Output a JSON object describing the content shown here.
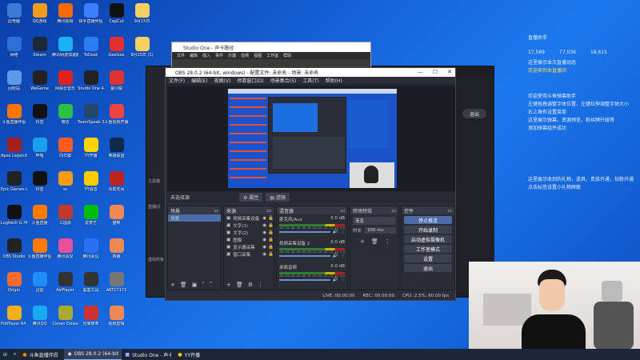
{
  "desktop": {
    "icons": [
      {
        "label": "此电脑",
        "c": "#3a7bd5"
      },
      {
        "label": "QQ游戏",
        "c": "#f29c1f"
      },
      {
        "label": "腾讯视频",
        "c": "#ff6a00"
      },
      {
        "label": "快手直播伴侣",
        "c": "#3b7fff"
      },
      {
        "label": "CapCut",
        "c": "#111"
      },
      {
        "label": "9月15日",
        "c": "#f3d061"
      },
      {
        "label": "网络",
        "c": "#2c6fd6"
      },
      {
        "label": "Steam",
        "c": "#1b2838"
      },
      {
        "label": "腾讯网游加速器",
        "c": "#1db0f4"
      },
      {
        "label": "ToDesk",
        "c": "#2d7cf6"
      },
      {
        "label": "GeeGee",
        "c": "#e03030"
      },
      {
        "label": "9月15日 (1)",
        "c": "#f3d061"
      },
      {
        "label": "回收站",
        "c": "#5b9ae8"
      },
      {
        "label": "WeGame",
        "c": "#222"
      },
      {
        "label": "网易云音乐",
        "c": "#e1211c"
      },
      {
        "label": "Studio One 4",
        "c": "#222"
      },
      {
        "label": "金闪锐",
        "c": "#d33"
      },
      {
        "label": "斗鱼直播伴侣",
        "c": "#ff7300"
      },
      {
        "label": "抖音",
        "c": "#111"
      },
      {
        "label": "微信",
        "c": "#2ac145"
      },
      {
        "label": "TeamSpeak 3",
        "c": "#23486b"
      },
      {
        "label": "斗鱼视频开播",
        "c": "#e44"
      },
      {
        "label": "Apex Legends",
        "c": "#a3201e"
      },
      {
        "label": "哔哩",
        "c": "#1d9ff0"
      },
      {
        "label": "向日葵",
        "c": "#ff5a1f"
      },
      {
        "label": "YY开播",
        "c": "#ffd200"
      },
      {
        "label": "英雄联盟",
        "c": "#0f2a4a"
      },
      {
        "label": "Epic Games Launcher",
        "c": "#222"
      },
      {
        "label": "抖音",
        "c": "#111"
      },
      {
        "label": "ss",
        "c": "#f39c12"
      },
      {
        "label": "YY语音",
        "c": "#ffcc00"
      },
      {
        "label": "永劫无间",
        "c": "#b22"
      },
      {
        "label": "Logitech G HUB",
        "c": "#111"
      },
      {
        "label": "斗鱼直播",
        "c": "#ff7a00"
      },
      {
        "label": "三国杀",
        "c": "#c0392b"
      },
      {
        "label": "爱奇艺",
        "c": "#00be06"
      },
      {
        "label": "猫咪",
        "c": "#e85"
      },
      {
        "label": "OBS Studio",
        "c": "#222"
      },
      {
        "label": "斗鱼直播伴侣",
        "c": "#ff7a00"
      },
      {
        "label": "腾讯会议",
        "c": "#e94f9c"
      },
      {
        "label": "腾讯会议",
        "c": "#2b6ff5"
      },
      {
        "label": "转播",
        "c": "#e85"
      },
      {
        "label": "Origin",
        "c": "#f56c2d"
      },
      {
        "label": "迅雷",
        "c": "#1e8ef7"
      },
      {
        "label": "AirPlayer",
        "c": "#333"
      },
      {
        "label": "黑盒工具",
        "c": "#333"
      },
      {
        "label": "AKT17173",
        "c": "#777"
      },
      {
        "label": "PotPlayer 64 bit",
        "c": "#f2b01e"
      },
      {
        "label": "腾讯QQ",
        "c": "#19a9f2"
      },
      {
        "label": "Conan Exiles",
        "c": "#aa3"
      },
      {
        "label": "光荣使命",
        "c": "#c33"
      },
      {
        "label": "视频剪辑",
        "c": "#e85"
      }
    ]
  },
  "studio_window": {
    "title": "Studio One - 声卡路径",
    "menu": [
      "文件",
      "编辑",
      "插入",
      "事件",
      "乐器",
      "音频",
      "视图",
      "工作室",
      "帮助"
    ]
  },
  "streamer_app": {
    "sidebar": [
      "工具箱",
      "直播间",
      "虚拟形象"
    ],
    "right_buttons": [
      "退出"
    ]
  },
  "obs": {
    "title": "OBS 28.0.2 (64-bit, windows) - 配置文件: 未命名 - 场景: 未命名",
    "menu": [
      "文件(F)",
      "编辑(E)",
      "视图(V)",
      "停靠窗口(D)",
      "场景集合(S)",
      "工具(T)",
      "帮助(H)"
    ],
    "context": {
      "source": "未选择源",
      "props": "属性",
      "filters": "滤镜"
    },
    "scenes": {
      "title": "场景",
      "items": [
        "场景"
      ]
    },
    "sources": {
      "title": "来源",
      "items": [
        "视频采集设备",
        "文字(1)",
        "文字(2)",
        "图像",
        "显示器采集",
        "窗口采集"
      ]
    },
    "mixer": {
      "title": "混音器",
      "tracks": [
        {
          "name": "麦克风/Aux",
          "db": "0.0 dB"
        },
        {
          "name": "视频采集设备 2",
          "db": "0.0 dB"
        },
        {
          "name": "桌面音频",
          "db": "0.0 dB"
        }
      ],
      "scale": "-60 -55 -50 -45 -40 -35 -30 -25 -20 -15 -10 -5 0"
    },
    "transitions": {
      "title": "转场特效",
      "type": "渐变",
      "duration_label": "时长",
      "duration": "300 ms"
    },
    "controls": {
      "title": "控件",
      "stop_stream": "停止推流",
      "start_record": "开始录制",
      "virtual_cam": "启动虚拟摄像机",
      "studio_mode": "工作室模式",
      "settings": "设置",
      "exit": "退出"
    },
    "status": {
      "live": "LIVE: 00:00:00",
      "rec": "REC: 00:00:00",
      "cpu": "CPU: 2.5%, 60.00 fps"
    }
  },
  "notifications": {
    "header": "直播助手",
    "stats": [
      "17,569",
      "77,036",
      "18,615"
    ],
    "lines": [
      "这里展示本次直播动态",
      "欢迎来到本直播间"
    ],
    "tips": [
      "欢迎使用斗鱼弹幕助手",
      "左键拖拽调整字体位置，左键拉伸调整字体大小",
      "右上角有设置菜单",
      "这里展示弹幕，资源预览，粉丝牌升级等",
      "添加弹幕组件成功"
    ],
    "tips2": [
      "这里展示收到的礼物，道具，贵族开通，钻粉开通",
      "点击标签设置小礼物屏蔽"
    ]
  },
  "taskbar": {
    "items": [
      "斗鱼直播伴侣",
      "OBS 28.0.2 (64-bit...",
      "Studio One - 声卡...",
      "YY开播"
    ]
  }
}
